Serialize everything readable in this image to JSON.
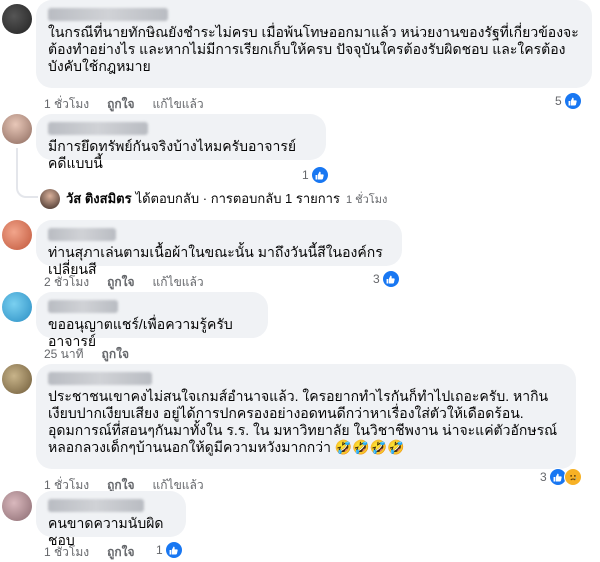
{
  "comments": [
    {
      "text": "ในกรณีที่นายทักษิณยังชำระไม่ครบ เมื่อพ้นโทษออกมาแล้ว หน่วยงานของรัฐที่เกี่ยวข้องจะต้องทำอย่างไร และหากไม่มีการเรียกเก็บให้ครบ ปัจจุบันใครต้องรับผิดชอบ และใครต้องบังคับใช้กฎหมาย",
      "time": "1 ชั่วโมง",
      "like_label": "ถูกใจ",
      "edited_label": "แก้ไขแล้ว",
      "reactions": "5"
    },
    {
      "text": "มีการยึดทรัพย์กันจริงบ้างไหมครับอาจารย์คดีแบบนี้",
      "reactions": "1",
      "reply": {
        "author": "วัส ติงสมิตร",
        "action": "ได้ตอบกลับ · การตอบกลับ 1 รายการ",
        "time": "1 ชั่วโมง"
      }
    },
    {
      "text": "ท่านสุภาเล่นตามเนื้อผ้าในขณะนั้น มาถึงวันนี้สีในองค์กรเปลี่ยนสี",
      "time": "2 ชั่วโมง",
      "like_label": "ถูกใจ",
      "edited_label": "แก้ไขแล้ว",
      "reactions": "3"
    },
    {
      "text": "ขออนุญาตแชร์/เพื่อความรู้ครับอาจารย์",
      "time": "25 นาที",
      "like_label": "ถูกใจ"
    },
    {
      "text": "ประชาชนเขาคงไม่สนใจเกมส์อำนาจแล้ว. ใครอยากทำไรกันก็ทำไปเถอะครับ. หากินเงียบปากเงียบเสียง อยู่ได้การปกครองอย่างอดทนดีกว่าหาเรื่องใส่ตัวให้เดือดร้อน. อุดมการณ์ที่สอนๆกันมาทั้งใน ร.ร. ใน มหาวิทยาลัย ในวิชาชีพงาน น่าจะแค่ตัวอักษรณ์หลอกลวงเด็กๆบ้านนอกให้ดูมีความหวังมากกว่า 🤣🤣🤣🤣",
      "time": "1 ชั่วโมง",
      "like_label": "ถูกใจ",
      "edited_label": "แก้ไขแล้ว",
      "reactions": "3"
    },
    {
      "text": "คนขาดความนับผิดชอบ",
      "time": "1 ชั่วโมง",
      "like_label": "ถูกใจ",
      "reactions": "1"
    }
  ],
  "colors": {
    "like_blue": "#1877f2",
    "bubble_bg": "#f0f2f5",
    "muted": "#65676b"
  },
  "icons": {
    "like": "thumbs-up-icon",
    "sad": "sad-face-icon"
  }
}
